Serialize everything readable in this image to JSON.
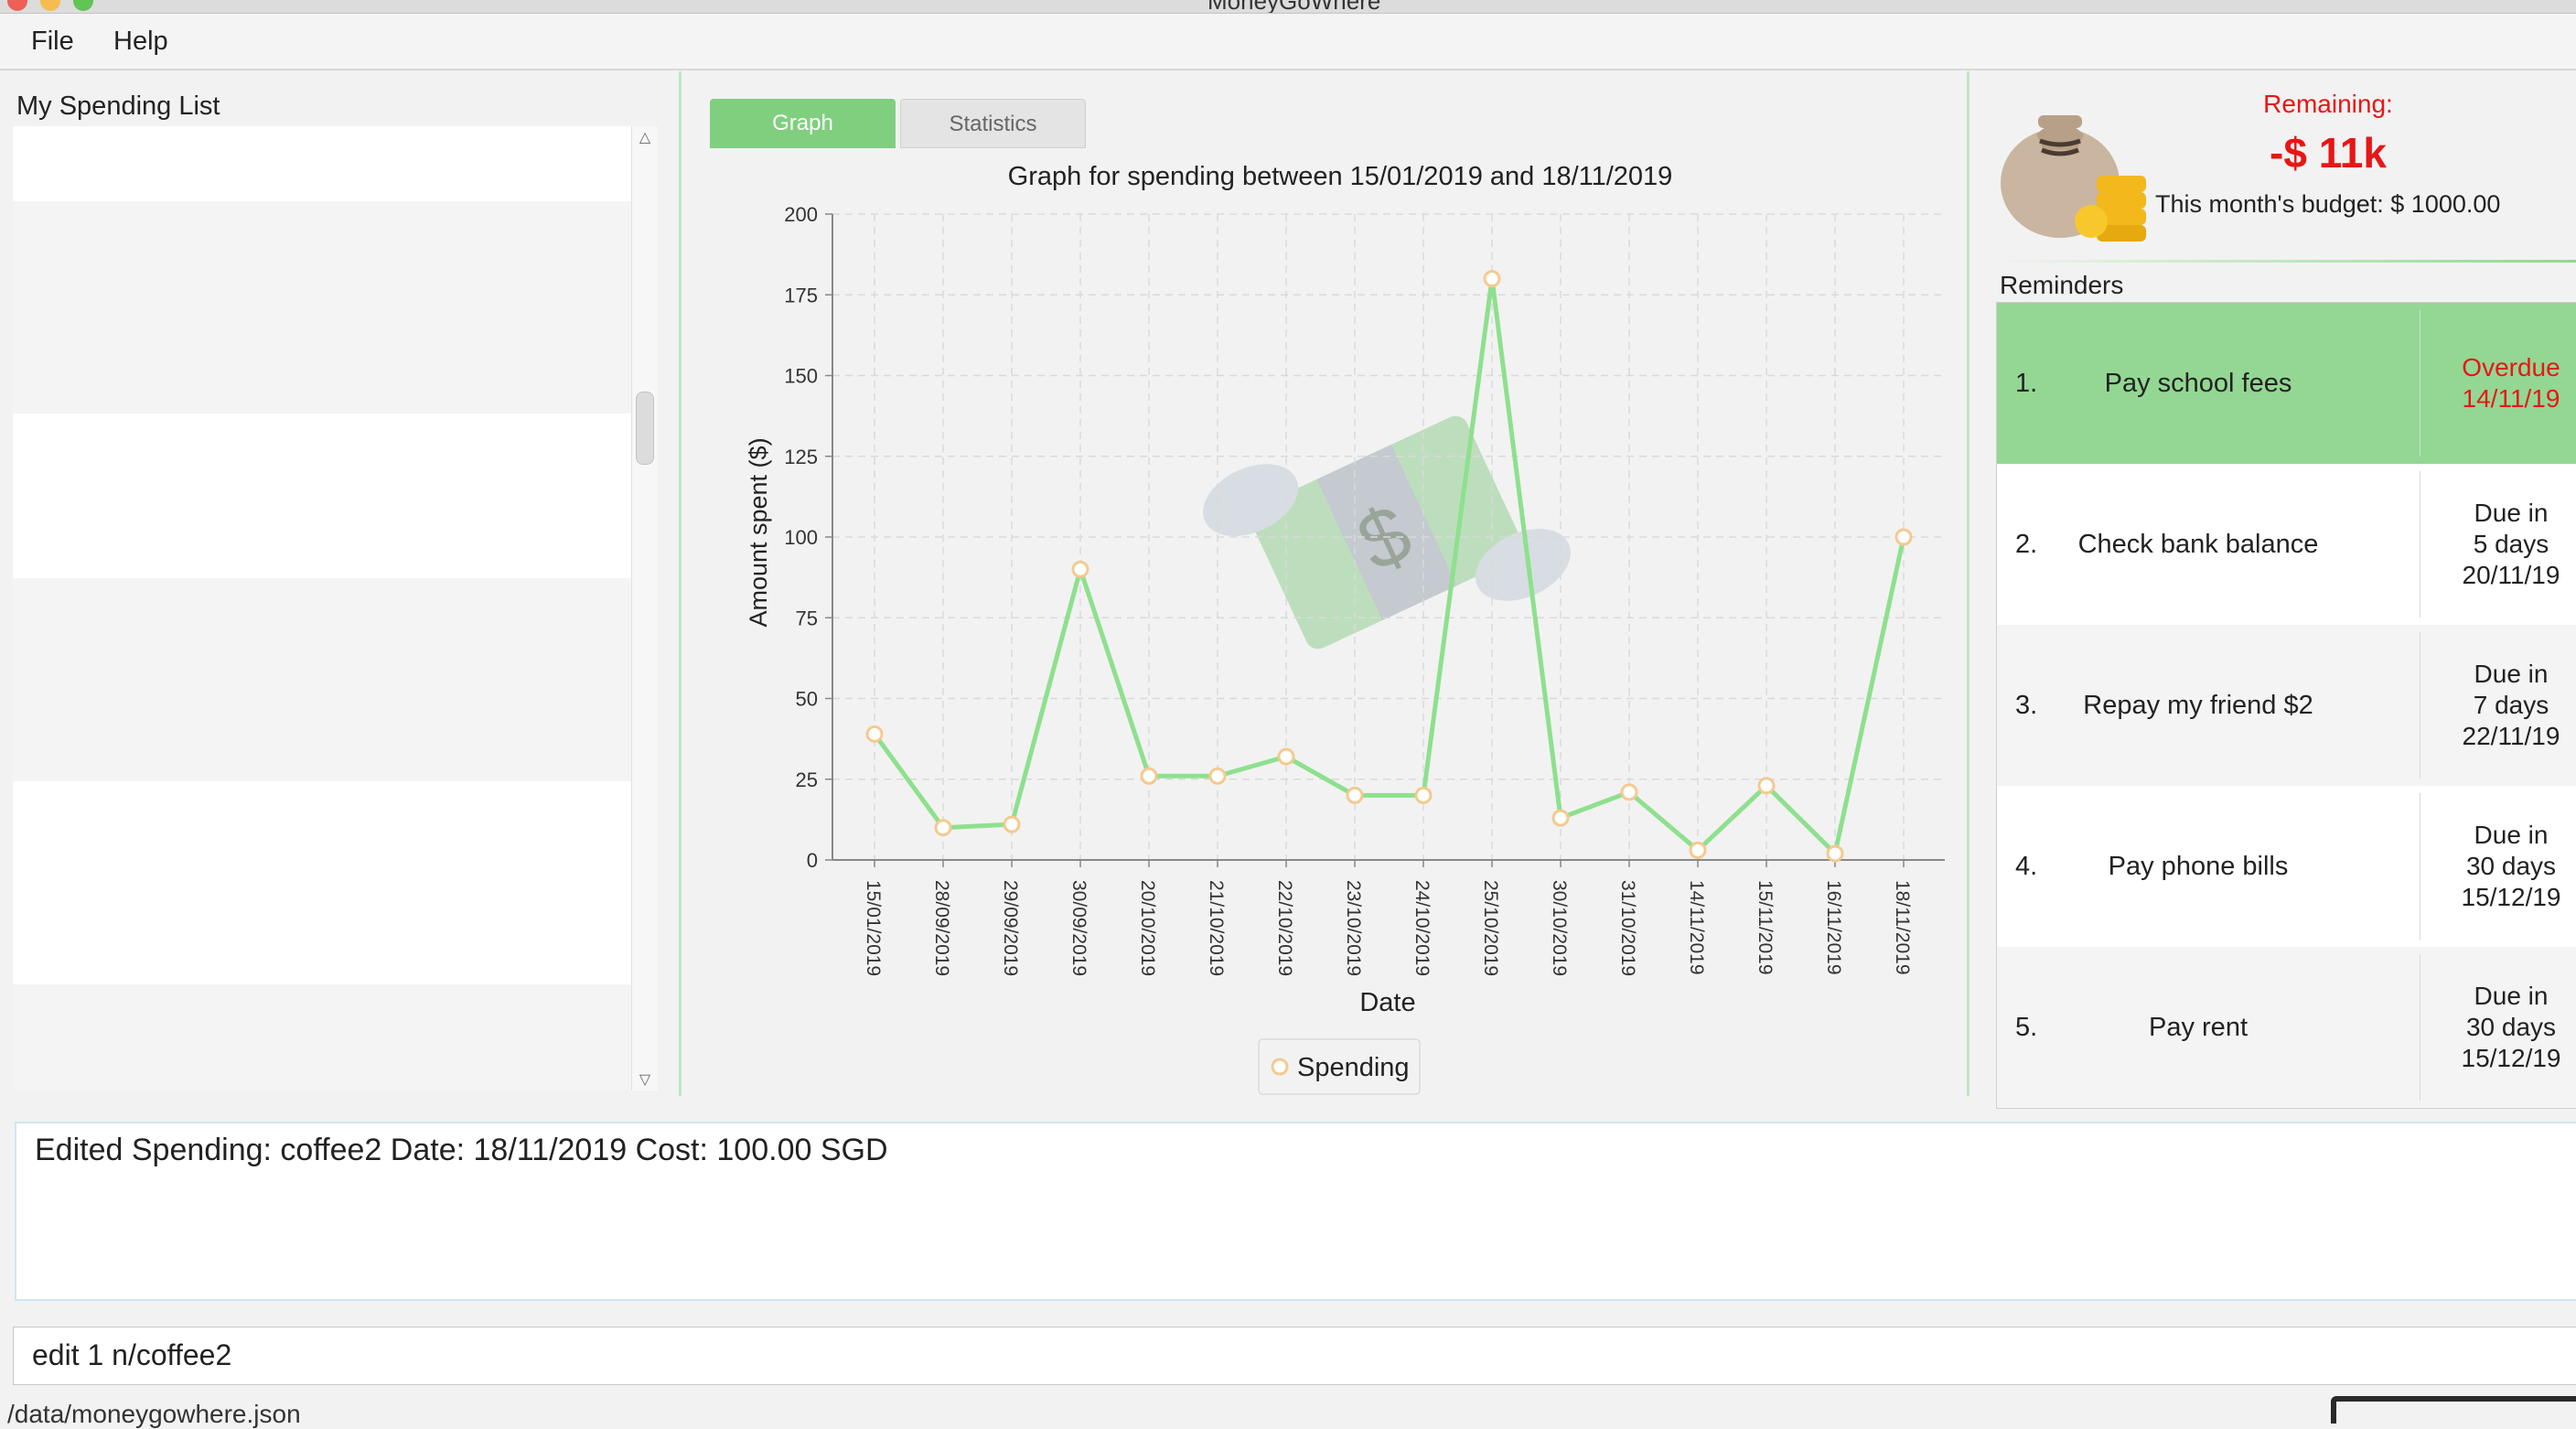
{
  "window": {
    "title": "MoneyGoWhere"
  },
  "menu": {
    "file": "File",
    "help": "Help"
  },
  "spending_list": {
    "title": "My Spending List"
  },
  "tabs": {
    "graph": "Graph",
    "statistics": "Statistics"
  },
  "budget": {
    "remaining_label": "Remaining:",
    "remaining_value": "-$ 11k",
    "monthly_budget": "This month's budget: $ 1000.00"
  },
  "reminders": {
    "title": "Reminders",
    "items": [
      {
        "num": "1.",
        "desc": "Pay school fees",
        "due": [
          "Overdue",
          "14/11/19"
        ]
      },
      {
        "num": "2.",
        "desc": "Check bank balance",
        "due": [
          "Due in",
          "5 days",
          "20/11/19"
        ]
      },
      {
        "num": "3.",
        "desc": "Repay my friend $2",
        "due": [
          "Due in",
          "7 days",
          "22/11/19"
        ]
      },
      {
        "num": "4.",
        "desc": "Pay phone bills",
        "due": [
          "Due in",
          "30 days",
          "15/12/19"
        ]
      },
      {
        "num": "5.",
        "desc": "Pay rent",
        "due": [
          "Due in",
          "30 days",
          "15/12/19"
        ]
      }
    ]
  },
  "result": {
    "text": "Edited Spending: coffee2 Date: 18/11/2019 Cost: 100.00 SGD"
  },
  "command": {
    "value": "edit 1 n/coffee2"
  },
  "status": {
    "path": "/data/moneygowhere.json"
  },
  "colors": {
    "accent": "#7fcf7f",
    "line": "#8ee08e",
    "negative": "#e81616",
    "marker": "#f5c98f"
  },
  "chart_data": {
    "type": "line",
    "title": "Graph for spending between 15/01/2019 and 18/11/2019",
    "xlabel": "Date",
    "ylabel": "Amount spent ($)",
    "ylim": [
      0,
      200
    ],
    "yticks": [
      0,
      25,
      50,
      75,
      100,
      125,
      150,
      175,
      200
    ],
    "grid": true,
    "legend_position": "bottom-center",
    "x": [
      "15/01/2019",
      "28/09/2019",
      "29/09/2019",
      "30/09/2019",
      "20/10/2019",
      "21/10/2019",
      "22/10/2019",
      "23/10/2019",
      "24/10/2019",
      "25/10/2019",
      "30/10/2019",
      "31/10/2019",
      "14/11/2019",
      "15/11/2019",
      "16/11/2019",
      "18/11/2019"
    ],
    "series": [
      {
        "name": "Spending",
        "values": [
          39,
          10,
          11,
          90,
          26,
          26,
          32,
          20,
          20,
          180,
          13,
          21,
          3,
          23,
          2,
          100
        ]
      }
    ]
  }
}
